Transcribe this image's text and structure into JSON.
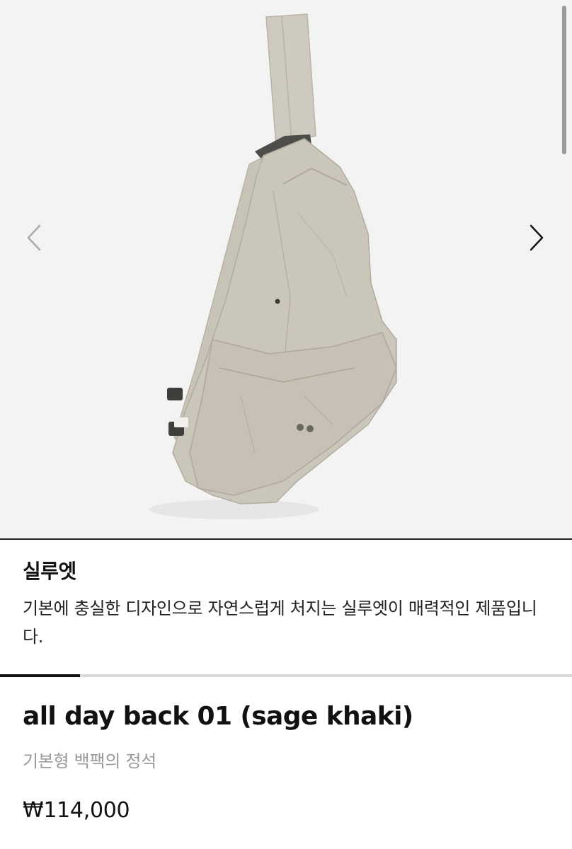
{
  "gallery": {
    "prev_icon": "chevron-left-icon",
    "next_icon": "chevron-right-icon",
    "image": "backpack-product-photo",
    "progress": 0.14
  },
  "caption": {
    "title": "실루엣",
    "text": "기본에 충실한 디자인으로 자연스럽게 처지는 실루엣이 매력적인 제품입니다."
  },
  "product": {
    "name": "all day back 01 (sage khaki)",
    "subtitle": "기본형 백팩의 정석",
    "price": "₩114,000"
  },
  "colors": {
    "background": "#f3f3f3",
    "bag": "#cbc6ba",
    "text": "#111111",
    "subtext": "#9a9a9a"
  }
}
